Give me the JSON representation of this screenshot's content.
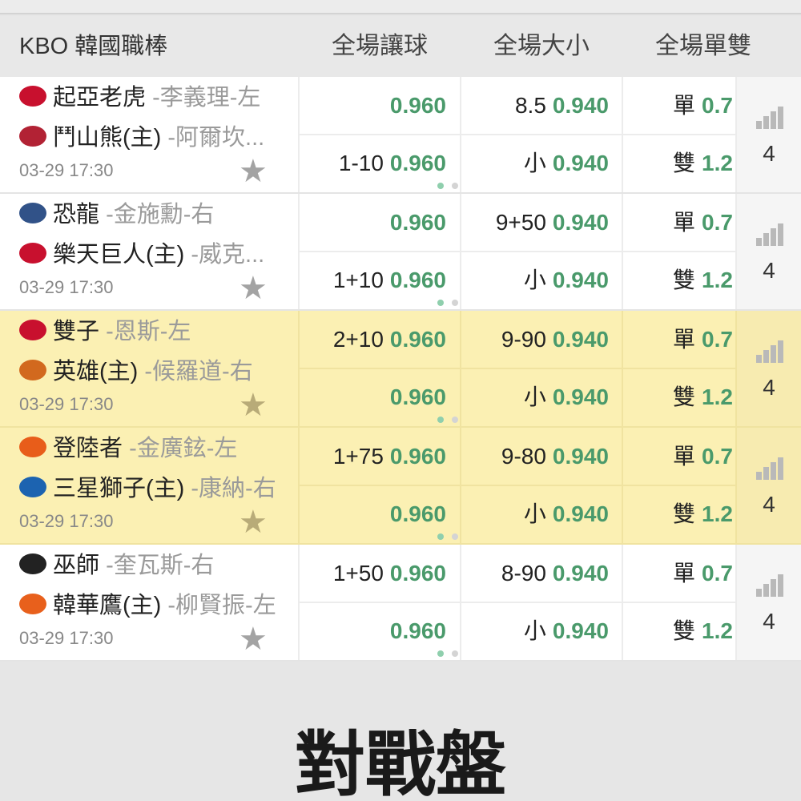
{
  "header": {
    "league": "KBO 韓國職棒",
    "col_handicap": "全場讓球",
    "col_total": "全場大小",
    "col_oddeven": "全場單雙"
  },
  "matches": [
    {
      "highlight": false,
      "team1": {
        "name": "起亞老虎",
        "pitcher": " -李義理-左",
        "logo_color": "#c8102e"
      },
      "team2": {
        "name": "鬥山熊(主)",
        "pitcher": " -阿爾坎...",
        "logo_color": "#b22234"
      },
      "time": "03-29 17:30",
      "hc1_line": "",
      "hc1_odd": "0.960",
      "hc2_line": "1-10",
      "hc2_odd": "0.960",
      "ou1_line": "8.5",
      "ou1_odd": "0.940",
      "ou2_line": "小",
      "ou2_odd": "0.940",
      "oe1_line": "單",
      "oe1_odd": "0.7",
      "oe2_line": "雙",
      "oe2_odd": "1.2",
      "count": "4"
    },
    {
      "highlight": false,
      "team1": {
        "name": "恐龍",
        "pitcher": " -金施勳-右",
        "logo_color": "#315288"
      },
      "team2": {
        "name": "樂天巨人(主)",
        "pitcher": " -威克...",
        "logo_color": "#c8102e"
      },
      "time": "03-29 17:30",
      "hc1_line": "",
      "hc1_odd": "0.960",
      "hc2_line": "1+10",
      "hc2_odd": "0.960",
      "ou1_line": "9+50",
      "ou1_odd": "0.940",
      "ou2_line": "小",
      "ou2_odd": "0.940",
      "oe1_line": "單",
      "oe1_odd": "0.7",
      "oe2_line": "雙",
      "oe2_odd": "1.2",
      "count": "4"
    },
    {
      "highlight": true,
      "team1": {
        "name": "雙子",
        "pitcher": " -恩斯-左",
        "logo_color": "#c8102e"
      },
      "team2": {
        "name": "英雄(主)",
        "pitcher": " -候羅道-右",
        "logo_color": "#d2691e"
      },
      "time": "03-29 17:30",
      "hc1_line": "2+10",
      "hc1_odd": "0.960",
      "hc2_line": "",
      "hc2_odd": "0.960",
      "ou1_line": "9-90",
      "ou1_odd": "0.940",
      "ou2_line": "小",
      "ou2_odd": "0.940",
      "oe1_line": "單",
      "oe1_odd": "0.7",
      "oe2_line": "雙",
      "oe2_odd": "1.2",
      "count": "4"
    },
    {
      "highlight": true,
      "team1": {
        "name": "登陸者",
        "pitcher": " -金廣鉉-左",
        "logo_color": "#e85d1a"
      },
      "team2": {
        "name": "三星獅子(主)",
        "pitcher": " -康納-右",
        "logo_color": "#1c63b0"
      },
      "time": "03-29 17:30",
      "hc1_line": "1+75",
      "hc1_odd": "0.960",
      "hc2_line": "",
      "hc2_odd": "0.960",
      "ou1_line": "9-80",
      "ou1_odd": "0.940",
      "ou2_line": "小",
      "ou2_odd": "0.940",
      "oe1_line": "單",
      "oe1_odd": "0.7",
      "oe2_line": "雙",
      "oe2_odd": "1.2",
      "count": "4"
    },
    {
      "highlight": false,
      "team1": {
        "name": "巫師",
        "pitcher": " -奎瓦斯-右",
        "logo_color": "#222222"
      },
      "team2": {
        "name": "韓華鷹(主)",
        "pitcher": " -柳賢振-左",
        "logo_color": "#e8601c"
      },
      "time": "03-29 17:30",
      "hc1_line": "1+50",
      "hc1_odd": "0.960",
      "hc2_line": "",
      "hc2_odd": "0.960",
      "ou1_line": "8-90",
      "ou1_odd": "0.940",
      "ou2_line": "小",
      "ou2_odd": "0.940",
      "oe1_line": "單",
      "oe1_odd": "0.7",
      "oe2_line": "雙",
      "oe2_odd": "1.2",
      "count": "4"
    }
  ],
  "footer": {
    "caption": "對戰盤"
  },
  "icons": {
    "favorite": "star-icon",
    "stats": "signal-bars-icon",
    "pager": "page-dots-icon"
  },
  "colors": {
    "odds_green": "#4a9a6b",
    "highlight_row": "#fbf0b3"
  }
}
